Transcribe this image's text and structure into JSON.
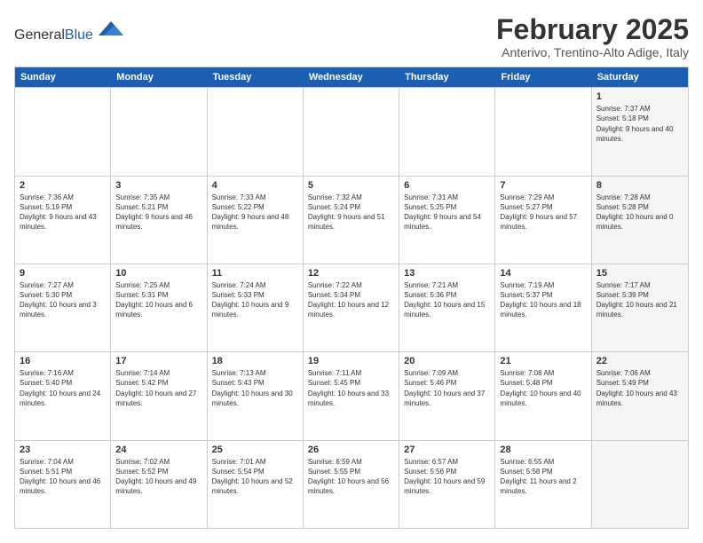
{
  "header": {
    "logo_general": "General",
    "logo_blue": "Blue",
    "month_title": "February 2025",
    "location": "Anterivo, Trentino-Alto Adige, Italy"
  },
  "day_headers": [
    "Sunday",
    "Monday",
    "Tuesday",
    "Wednesday",
    "Thursday",
    "Friday",
    "Saturday"
  ],
  "weeks": [
    [
      {
        "num": "",
        "info": "",
        "empty": true
      },
      {
        "num": "",
        "info": "",
        "empty": true
      },
      {
        "num": "",
        "info": "",
        "empty": true
      },
      {
        "num": "",
        "info": "",
        "empty": true
      },
      {
        "num": "",
        "info": "",
        "empty": true
      },
      {
        "num": "",
        "info": "",
        "empty": true
      },
      {
        "num": "1",
        "info": "Sunrise: 7:37 AM\nSunset: 5:18 PM\nDaylight: 9 hours and 40 minutes.",
        "empty": false,
        "shaded": true
      }
    ],
    [
      {
        "num": "2",
        "info": "Sunrise: 7:36 AM\nSunset: 5:19 PM\nDaylight: 9 hours and 43 minutes.",
        "empty": false,
        "shaded": false
      },
      {
        "num": "3",
        "info": "Sunrise: 7:35 AM\nSunset: 5:21 PM\nDaylight: 9 hours and 46 minutes.",
        "empty": false,
        "shaded": false
      },
      {
        "num": "4",
        "info": "Sunrise: 7:33 AM\nSunset: 5:22 PM\nDaylight: 9 hours and 48 minutes.",
        "empty": false,
        "shaded": false
      },
      {
        "num": "5",
        "info": "Sunrise: 7:32 AM\nSunset: 5:24 PM\nDaylight: 9 hours and 51 minutes.",
        "empty": false,
        "shaded": false
      },
      {
        "num": "6",
        "info": "Sunrise: 7:31 AM\nSunset: 5:25 PM\nDaylight: 9 hours and 54 minutes.",
        "empty": false,
        "shaded": false
      },
      {
        "num": "7",
        "info": "Sunrise: 7:29 AM\nSunset: 5:27 PM\nDaylight: 9 hours and 57 minutes.",
        "empty": false,
        "shaded": false
      },
      {
        "num": "8",
        "info": "Sunrise: 7:28 AM\nSunset: 5:28 PM\nDaylight: 10 hours and 0 minutes.",
        "empty": false,
        "shaded": true
      }
    ],
    [
      {
        "num": "9",
        "info": "Sunrise: 7:27 AM\nSunset: 5:30 PM\nDaylight: 10 hours and 3 minutes.",
        "empty": false,
        "shaded": false
      },
      {
        "num": "10",
        "info": "Sunrise: 7:25 AM\nSunset: 5:31 PM\nDaylight: 10 hours and 6 minutes.",
        "empty": false,
        "shaded": false
      },
      {
        "num": "11",
        "info": "Sunrise: 7:24 AM\nSunset: 5:33 PM\nDaylight: 10 hours and 9 minutes.",
        "empty": false,
        "shaded": false
      },
      {
        "num": "12",
        "info": "Sunrise: 7:22 AM\nSunset: 5:34 PM\nDaylight: 10 hours and 12 minutes.",
        "empty": false,
        "shaded": false
      },
      {
        "num": "13",
        "info": "Sunrise: 7:21 AM\nSunset: 5:36 PM\nDaylight: 10 hours and 15 minutes.",
        "empty": false,
        "shaded": false
      },
      {
        "num": "14",
        "info": "Sunrise: 7:19 AM\nSunset: 5:37 PM\nDaylight: 10 hours and 18 minutes.",
        "empty": false,
        "shaded": false
      },
      {
        "num": "15",
        "info": "Sunrise: 7:17 AM\nSunset: 5:39 PM\nDaylight: 10 hours and 21 minutes.",
        "empty": false,
        "shaded": true
      }
    ],
    [
      {
        "num": "16",
        "info": "Sunrise: 7:16 AM\nSunset: 5:40 PM\nDaylight: 10 hours and 24 minutes.",
        "empty": false,
        "shaded": false
      },
      {
        "num": "17",
        "info": "Sunrise: 7:14 AM\nSunset: 5:42 PM\nDaylight: 10 hours and 27 minutes.",
        "empty": false,
        "shaded": false
      },
      {
        "num": "18",
        "info": "Sunrise: 7:13 AM\nSunset: 5:43 PM\nDaylight: 10 hours and 30 minutes.",
        "empty": false,
        "shaded": false
      },
      {
        "num": "19",
        "info": "Sunrise: 7:11 AM\nSunset: 5:45 PM\nDaylight: 10 hours and 33 minutes.",
        "empty": false,
        "shaded": false
      },
      {
        "num": "20",
        "info": "Sunrise: 7:09 AM\nSunset: 5:46 PM\nDaylight: 10 hours and 37 minutes.",
        "empty": false,
        "shaded": false
      },
      {
        "num": "21",
        "info": "Sunrise: 7:08 AM\nSunset: 5:48 PM\nDaylight: 10 hours and 40 minutes.",
        "empty": false,
        "shaded": false
      },
      {
        "num": "22",
        "info": "Sunrise: 7:06 AM\nSunset: 5:49 PM\nDaylight: 10 hours and 43 minutes.",
        "empty": false,
        "shaded": true
      }
    ],
    [
      {
        "num": "23",
        "info": "Sunrise: 7:04 AM\nSunset: 5:51 PM\nDaylight: 10 hours and 46 minutes.",
        "empty": false,
        "shaded": false
      },
      {
        "num": "24",
        "info": "Sunrise: 7:02 AM\nSunset: 5:52 PM\nDaylight: 10 hours and 49 minutes.",
        "empty": false,
        "shaded": false
      },
      {
        "num": "25",
        "info": "Sunrise: 7:01 AM\nSunset: 5:54 PM\nDaylight: 10 hours and 52 minutes.",
        "empty": false,
        "shaded": false
      },
      {
        "num": "26",
        "info": "Sunrise: 6:59 AM\nSunset: 5:55 PM\nDaylight: 10 hours and 56 minutes.",
        "empty": false,
        "shaded": false
      },
      {
        "num": "27",
        "info": "Sunrise: 6:57 AM\nSunset: 5:56 PM\nDaylight: 10 hours and 59 minutes.",
        "empty": false,
        "shaded": false
      },
      {
        "num": "28",
        "info": "Sunrise: 6:55 AM\nSunset: 5:58 PM\nDaylight: 11 hours and 2 minutes.",
        "empty": false,
        "shaded": false
      },
      {
        "num": "",
        "info": "",
        "empty": true,
        "shaded": true
      }
    ]
  ]
}
